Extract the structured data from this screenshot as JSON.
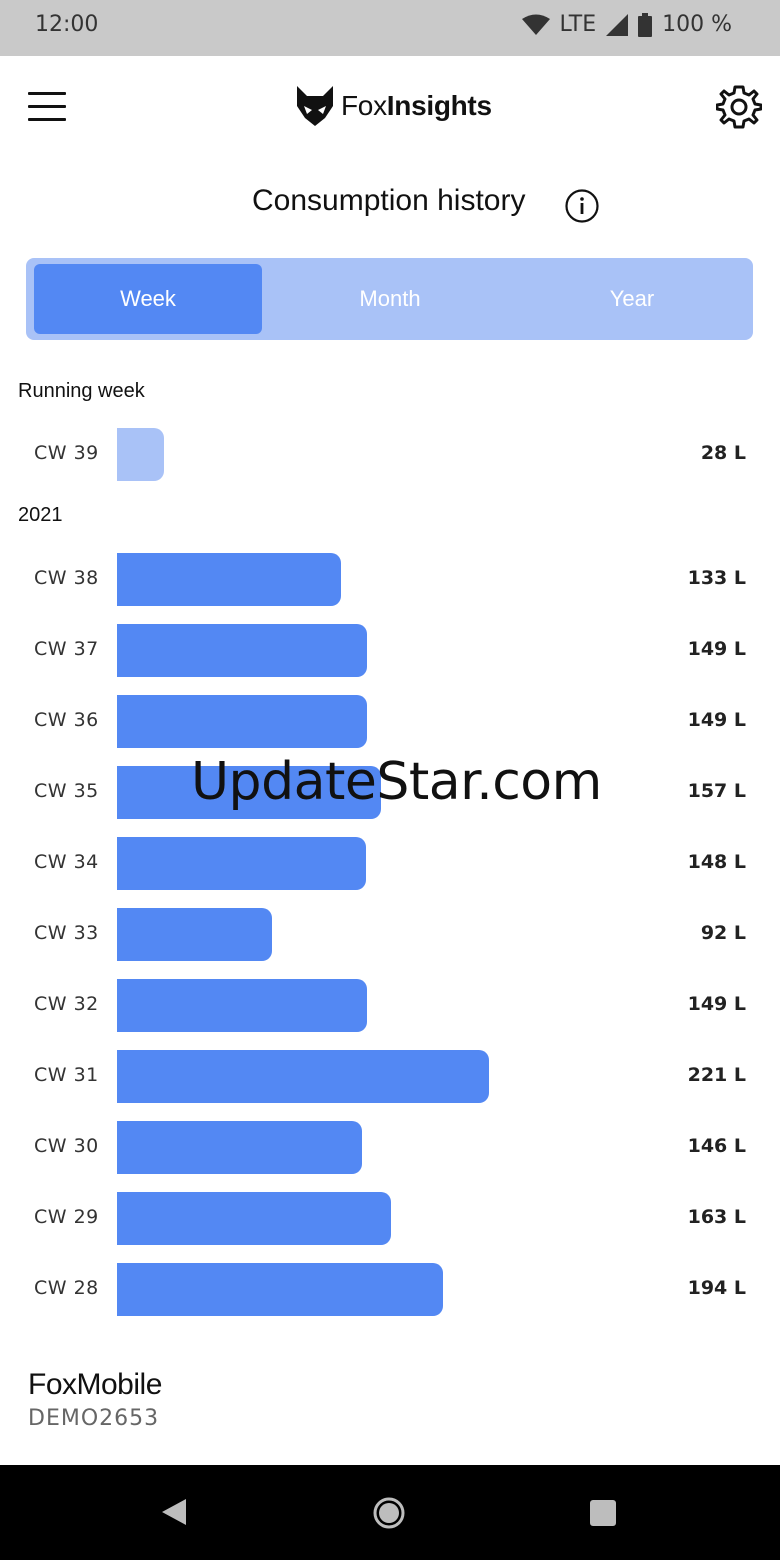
{
  "status_bar": {
    "time": "12:00",
    "network": "LTE",
    "battery": "100 %",
    "icons": [
      "wifi-icon",
      "signal-icon",
      "battery-icon"
    ]
  },
  "app_bar": {
    "brand_light": "Fox",
    "brand_bold": "Insights",
    "icons": [
      "menu-icon",
      "fox-logo-icon",
      "gear-icon"
    ]
  },
  "page": {
    "title": "Consumption history",
    "info_icon": "info-icon"
  },
  "tabs": [
    {
      "label": "Week",
      "active": true
    },
    {
      "label": "Month",
      "active": false
    },
    {
      "label": "Year",
      "active": false
    }
  ],
  "sections": {
    "running": "Running week",
    "year": "2021"
  },
  "chart_data": {
    "type": "bar",
    "orientation": "horizontal",
    "unit": "L",
    "running_week": {
      "category": "CW 39",
      "value": 28,
      "label": "28 L"
    },
    "categories": [
      "CW 38",
      "CW 37",
      "CW 36",
      "CW 35",
      "CW 34",
      "CW 33",
      "CW 32",
      "CW 31",
      "CW 30",
      "CW 29",
      "CW 28"
    ],
    "values": [
      133,
      149,
      149,
      157,
      148,
      92,
      149,
      221,
      146,
      163,
      194
    ],
    "labels": [
      "133 L",
      "149 L",
      "149 L",
      "157 L",
      "148 L",
      "92 L",
      "149 L",
      "221 L",
      "146 L",
      "163 L",
      "194 L"
    ],
    "xlim": [
      0,
      370
    ],
    "colors": {
      "current": "#5388f3",
      "running": "#a9c2f7"
    }
  },
  "footer": {
    "name": "FoxMobile",
    "id": "DEMO2653"
  },
  "watermark": "UpdateStar.com",
  "nav": {
    "icons": [
      "back-icon",
      "home-icon",
      "recents-icon"
    ]
  },
  "colors": {
    "accent": "#5388f3",
    "accent_light": "#a9c2f7",
    "status_bar": "#c9c9c9",
    "nav_bar": "#000000"
  }
}
